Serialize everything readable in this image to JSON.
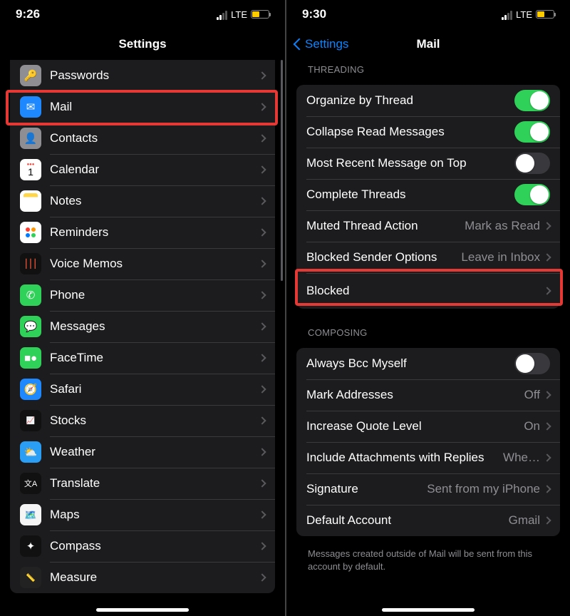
{
  "left": {
    "status": {
      "time": "9:26",
      "carrier": "LTE"
    },
    "nav": {
      "title": "Settings"
    },
    "items": [
      {
        "label": "Passwords",
        "icon": "key-icon"
      },
      {
        "label": "Mail",
        "icon": "mail-icon",
        "highlighted": true
      },
      {
        "label": "Contacts",
        "icon": "contacts-icon"
      },
      {
        "label": "Calendar",
        "icon": "calendar-icon"
      },
      {
        "label": "Notes",
        "icon": "notes-icon"
      },
      {
        "label": "Reminders",
        "icon": "reminders-icon"
      },
      {
        "label": "Voice Memos",
        "icon": "voice-memos-icon"
      },
      {
        "label": "Phone",
        "icon": "phone-icon"
      },
      {
        "label": "Messages",
        "icon": "messages-icon"
      },
      {
        "label": "FaceTime",
        "icon": "facetime-icon"
      },
      {
        "label": "Safari",
        "icon": "safari-icon"
      },
      {
        "label": "Stocks",
        "icon": "stocks-icon"
      },
      {
        "label": "Weather",
        "icon": "weather-icon"
      },
      {
        "label": "Translate",
        "icon": "translate-icon"
      },
      {
        "label": "Maps",
        "icon": "maps-icon"
      },
      {
        "label": "Compass",
        "icon": "compass-icon"
      },
      {
        "label": "Measure",
        "icon": "measure-icon"
      }
    ]
  },
  "right": {
    "status": {
      "time": "9:30",
      "carrier": "LTE"
    },
    "nav": {
      "back": "Settings",
      "title": "Mail"
    },
    "threading_header": "THREADING",
    "threading": [
      {
        "label": "Organize by Thread",
        "kind": "switch",
        "on": true
      },
      {
        "label": "Collapse Read Messages",
        "kind": "switch",
        "on": true
      },
      {
        "label": "Most Recent Message on Top",
        "kind": "switch",
        "on": false
      },
      {
        "label": "Complete Threads",
        "kind": "switch",
        "on": true
      },
      {
        "label": "Muted Thread Action",
        "kind": "link",
        "detail": "Mark as Read"
      },
      {
        "label": "Blocked Sender Options",
        "kind": "link",
        "detail": "Leave in Inbox"
      },
      {
        "label": "Blocked",
        "kind": "link",
        "detail": "",
        "highlighted": true
      }
    ],
    "composing_header": "COMPOSING",
    "composing": [
      {
        "label": "Always Bcc Myself",
        "kind": "switch",
        "on": false
      },
      {
        "label": "Mark Addresses",
        "kind": "link",
        "detail": "Off"
      },
      {
        "label": "Increase Quote Level",
        "kind": "link",
        "detail": "On"
      },
      {
        "label": "Include Attachments with Replies",
        "kind": "link",
        "detail": "Whe…"
      },
      {
        "label": "Signature",
        "kind": "link",
        "detail": "Sent from my iPhone"
      },
      {
        "label": "Default Account",
        "kind": "link",
        "detail": "Gmail"
      }
    ],
    "composing_footer": "Messages created outside of Mail will be sent from this account by default."
  }
}
